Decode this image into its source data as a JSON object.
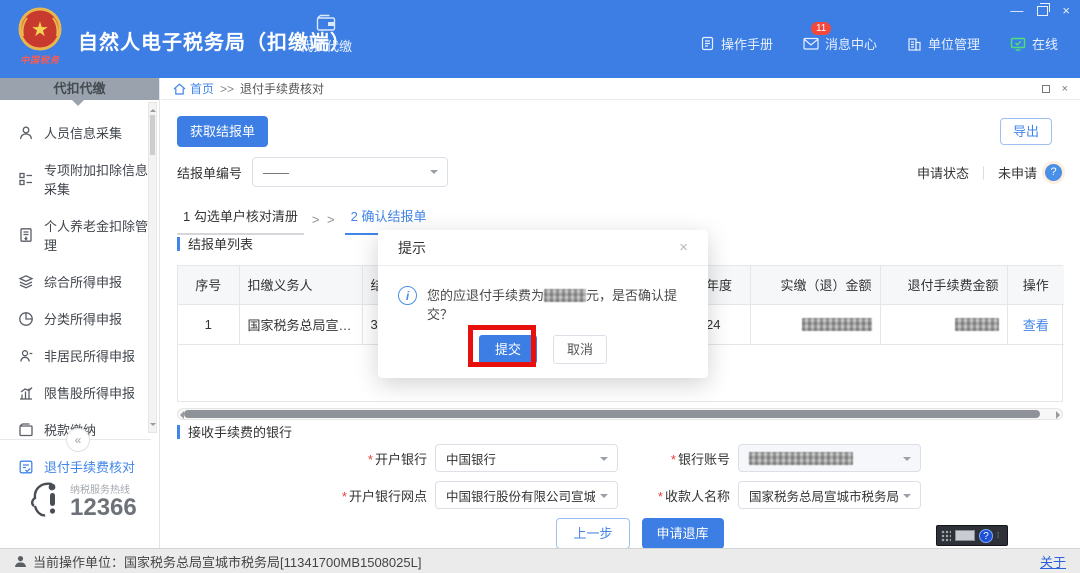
{
  "colors": {
    "accent": "#3d7ee4",
    "link": "#4285e8",
    "badge_red": "#f5483d",
    "online_green": "#3dbd5a",
    "annotation_red": "#e8100c"
  },
  "window_controls": {
    "minimize": "—",
    "close": "×"
  },
  "header": {
    "title": "自然人电子税务局（扣缴端）",
    "logo_caption": "中国税务",
    "nav_tab": "代扣代缴",
    "menu": [
      {
        "label": "操作手册",
        "icon": "manual-icon"
      },
      {
        "label": "消息中心",
        "icon": "message-icon",
        "badge": "11"
      },
      {
        "label": "单位管理",
        "icon": "org-icon"
      },
      {
        "label": "在线",
        "icon": "online-icon"
      }
    ]
  },
  "sidebar": {
    "header": "代扣代缴",
    "items": [
      {
        "label": "人员信息采集",
        "icon": "person-icon",
        "active": false
      },
      {
        "label": "专项附加扣除信息采集",
        "icon": "form-list-icon",
        "active": false
      },
      {
        "label": "个人养老金扣除管理",
        "icon": "pension-doc-icon",
        "active": false
      },
      {
        "label": "综合所得申报",
        "icon": "layers-icon",
        "active": false
      },
      {
        "label": "分类所得申报",
        "icon": "pie-icon",
        "active": false
      },
      {
        "label": "非居民所得申报",
        "icon": "person-alt-icon",
        "active": false
      },
      {
        "label": "限售股所得申报",
        "icon": "bar-chart-icon",
        "active": false
      },
      {
        "label": "税款缴纳",
        "icon": "wallet-icon",
        "active": false
      },
      {
        "label": "退付手续费核对",
        "icon": "doc-check-icon",
        "active": true
      }
    ],
    "collapse_glyph": "«",
    "hotline_caption": "纳税服务热线",
    "hotline_number": "12366"
  },
  "breadcrumb": {
    "home": "首页",
    "separator": ">>",
    "current": "退付手续费核对"
  },
  "toolbar": {
    "fetch_label": "获取结报单",
    "export_label": "导出"
  },
  "filter": {
    "label": "结报单编号",
    "value": "——",
    "status_label": "申请状态",
    "status_divider": "｜",
    "status_value": "未申请",
    "help_glyph": "?"
  },
  "steps": {
    "step1": "1 勾选单户核对清册",
    "separator": "> >",
    "step2": "2 确认结报单"
  },
  "list_section": {
    "title": "结报单列表",
    "headers": [
      "序号",
      "扣缴义务人",
      "结报单编号",
      "申报年度",
      "实缴（退）金额",
      "退付手续费金额",
      "操作"
    ],
    "row": {
      "seq": "1",
      "withholder": "国家税务总局宣城市...",
      "doc_no": "3",
      "year": "2024",
      "paid_amount_redacted": true,
      "fee_amount_redacted": true,
      "action": "查看"
    }
  },
  "bank_section": {
    "title": "接收手续费的银行",
    "required_mark": "*",
    "fields": [
      {
        "label": "开户银行",
        "value": "中国银行"
      },
      {
        "label": "银行账号",
        "value_redacted": true
      },
      {
        "label": "开户银行网点",
        "value": "中国银行股份有限公司宣城分行"
      },
      {
        "label": "收款人名称",
        "value": "国家税务总局宣城市税务局"
      }
    ],
    "prev_label": "上一步",
    "apply_label": "申请退库"
  },
  "dialog": {
    "title": "提示",
    "close_glyph": "×",
    "info_glyph": "i",
    "message_prefix": "您的应退付手续费为",
    "amount_redacted": true,
    "message_suffix": "元，是否确认提交？",
    "submit_label": "提交",
    "cancel_label": "取消"
  },
  "footer": {
    "operator": "当前操作单位：国家税务总局宣城市税务局[11341700MB1508025L]",
    "about": "关于"
  }
}
